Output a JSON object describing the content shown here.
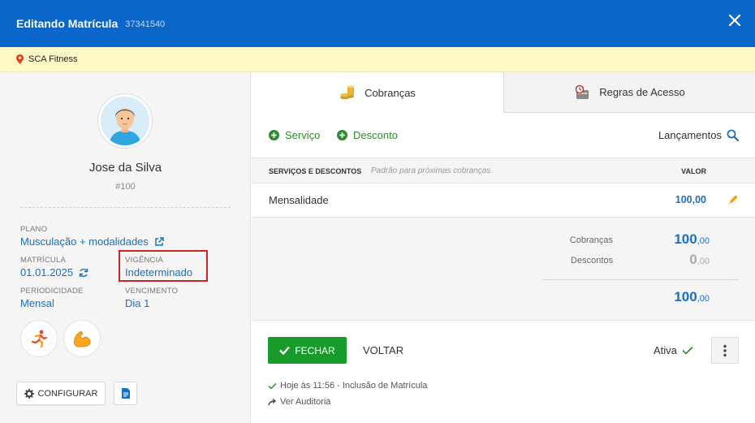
{
  "header": {
    "title": "Editando Matrícula",
    "id": "37341540"
  },
  "location": {
    "name": "SCA Fitness"
  },
  "profile": {
    "name": "Jose da Silva",
    "number": "#100"
  },
  "fields": {
    "plano": {
      "label": "PLANO",
      "value": "Musculação + modalidades"
    },
    "matricula": {
      "label": "MATRÍCULA",
      "value": "01.01.2025"
    },
    "vigencia": {
      "label": "VIGÊNCIA",
      "value": "Indeterminado"
    },
    "periodicidade": {
      "label": "PERIODICIDADE",
      "value": "Mensal"
    },
    "vencimento": {
      "label": "VENCIMENTO",
      "value": "Dia 1"
    }
  },
  "buttons": {
    "configurar": "CONFIGURAR"
  },
  "tabs": [
    {
      "label": "Cobranças"
    },
    {
      "label": "Regras de Acesso"
    }
  ],
  "actions": {
    "servico": "Serviço",
    "desconto": "Desconto",
    "lancamentos": "Lançamentos"
  },
  "table": {
    "header": {
      "col1": "SERVIÇOS E DESCONTOS",
      "col1_hint": "Padrão para próximas cobranças",
      "col2": "VALOR"
    },
    "rows": [
      {
        "name": "Mensalidade",
        "value": "100,00"
      }
    ]
  },
  "totals": {
    "cobrancas": {
      "label": "Cobranças",
      "int": "100",
      "dec": ",00"
    },
    "descontos": {
      "label": "Descontos",
      "int": "0",
      "dec": ",00"
    },
    "total": {
      "int": "100",
      "dec": ",00"
    }
  },
  "footer": {
    "fechar": "FECHAR",
    "voltar": "VOLTAR",
    "status": "Ativa",
    "log": "Hoje às 11:56 - Inclusão de Matrícula",
    "auditoria": "Ver Auditoria"
  },
  "colors": {
    "primary": "#0a66c9",
    "green": "#179c2b",
    "link": "#1a6fc0",
    "highlight": "#c62828"
  }
}
